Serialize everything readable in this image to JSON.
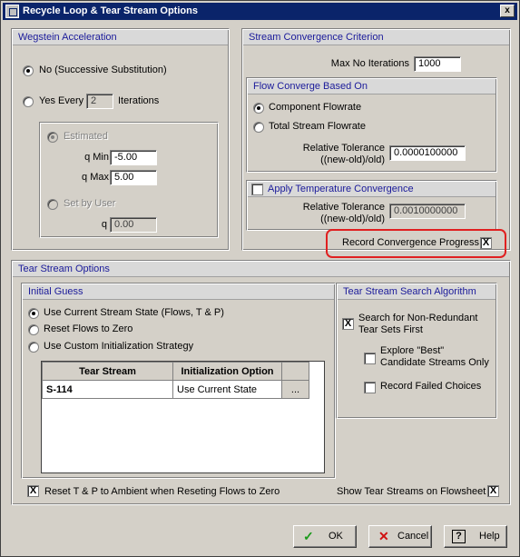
{
  "window": {
    "title": "Recycle Loop & Tear Stream Options",
    "close_glyph": "x"
  },
  "wegstein": {
    "header": "Wegstein Acceleration",
    "no_label": "No (Successive Substitution)",
    "yes_label": "Yes Every",
    "yes_value": "2",
    "iterations_label": "Iterations",
    "estimated_label": "Estimated",
    "qmin_label": "q Min",
    "qmin_value": "-5.00",
    "qmax_label": "q Max",
    "qmax_value": "5.00",
    "set_by_user_label": "Set by User",
    "q_label": "q",
    "q_value": "0.00"
  },
  "stream_convergence": {
    "header": "Stream Convergence Criterion",
    "max_iter_label": "Max No Iterations",
    "max_iter_value": "1000",
    "flow": {
      "header": "Flow Converge Based On",
      "component_label": "Component Flowrate",
      "total_label": "Total Stream Flowrate",
      "rel_tol_label": "Relative Tolerance",
      "rel_tol_sub": "((new-old)/old)",
      "rel_tol_value": "0.0000100000"
    },
    "temp": {
      "header": "Apply Temperature Convergence",
      "rel_tol_label": "Relative Tolerance",
      "rel_tol_sub": "((new-old)/old)",
      "rel_tol_value": "0.0010000000"
    },
    "record_label": "Record Convergence Progress",
    "record_checked": "X"
  },
  "tear": {
    "header": "Tear Stream Options",
    "initial_guess": {
      "header": "Initial Guess",
      "opt1": "Use Current Stream State (Flows, T & P)",
      "opt2": "Reset Flows to Zero",
      "opt3": "Use Custom Initialization Strategy",
      "col1": "Tear Stream",
      "col2": "Initialization Option",
      "row_stream": "S-114",
      "row_option": "Use Current State",
      "ellipsis": "..."
    },
    "search": {
      "header": "Tear Stream Search Algorithm",
      "nonred_label_1": "Search for Non-Redundant",
      "nonred_label_2": "Tear Sets First",
      "nonred_checked": "X",
      "best_label_1": "Explore \"Best\"",
      "best_label_2": "Candidate Streams Only",
      "failed_label": "Record Failed Choices"
    },
    "reset_tp_label": "Reset T & P to Ambient when Reseting Flows to Zero",
    "reset_tp_checked": "X",
    "show_tear_label": "Show Tear Streams on Flowsheet",
    "show_tear_checked": "X"
  },
  "buttons": {
    "ok": "OK",
    "cancel": "Cancel",
    "help": "Help",
    "ok_glyph": "✓",
    "cancel_glyph": "✕",
    "help_glyph": "?",
    "ok_color": "#1a9a1a",
    "cancel_color": "#d01010"
  }
}
